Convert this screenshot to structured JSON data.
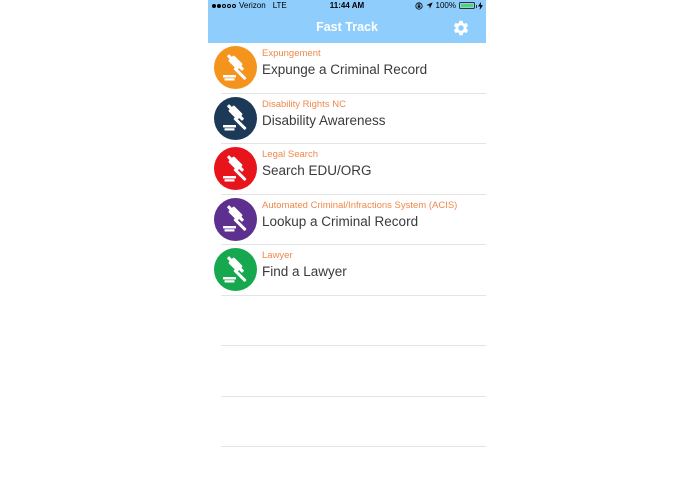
{
  "status_bar": {
    "carrier": "Verizon",
    "network": "LTE",
    "time": "11:44 AM",
    "battery": "100%",
    "signal_bars_filled": 2,
    "signal_bars_total": 5,
    "battery_level": 1.0
  },
  "nav": {
    "title": "Fast Track",
    "settings_icon": "gear-icon"
  },
  "colors": {
    "bar": "#8fcdfc",
    "subtitle": "#f0884a"
  },
  "items": [
    {
      "subtitle": "Expungement",
      "title": "Expunge a Criminal Record",
      "color": "#f5941d",
      "icon": "gavel-icon"
    },
    {
      "subtitle": "Disability Rights NC",
      "title": "Disability Awareness",
      "color": "#1c3a57",
      "icon": "gavel-icon"
    },
    {
      "subtitle": "Legal Search",
      "title": "Search EDU/ORG",
      "color": "#e8141c",
      "icon": "gavel-icon"
    },
    {
      "subtitle": "Automated Criminal/Infractions System (ACIS)",
      "title": "Lookup a Criminal Record",
      "color": "#5d2f8e",
      "icon": "gavel-icon"
    },
    {
      "subtitle": "Lawyer",
      "title": "Find a Lawyer",
      "color": "#16a84f",
      "icon": "gavel-icon"
    }
  ]
}
